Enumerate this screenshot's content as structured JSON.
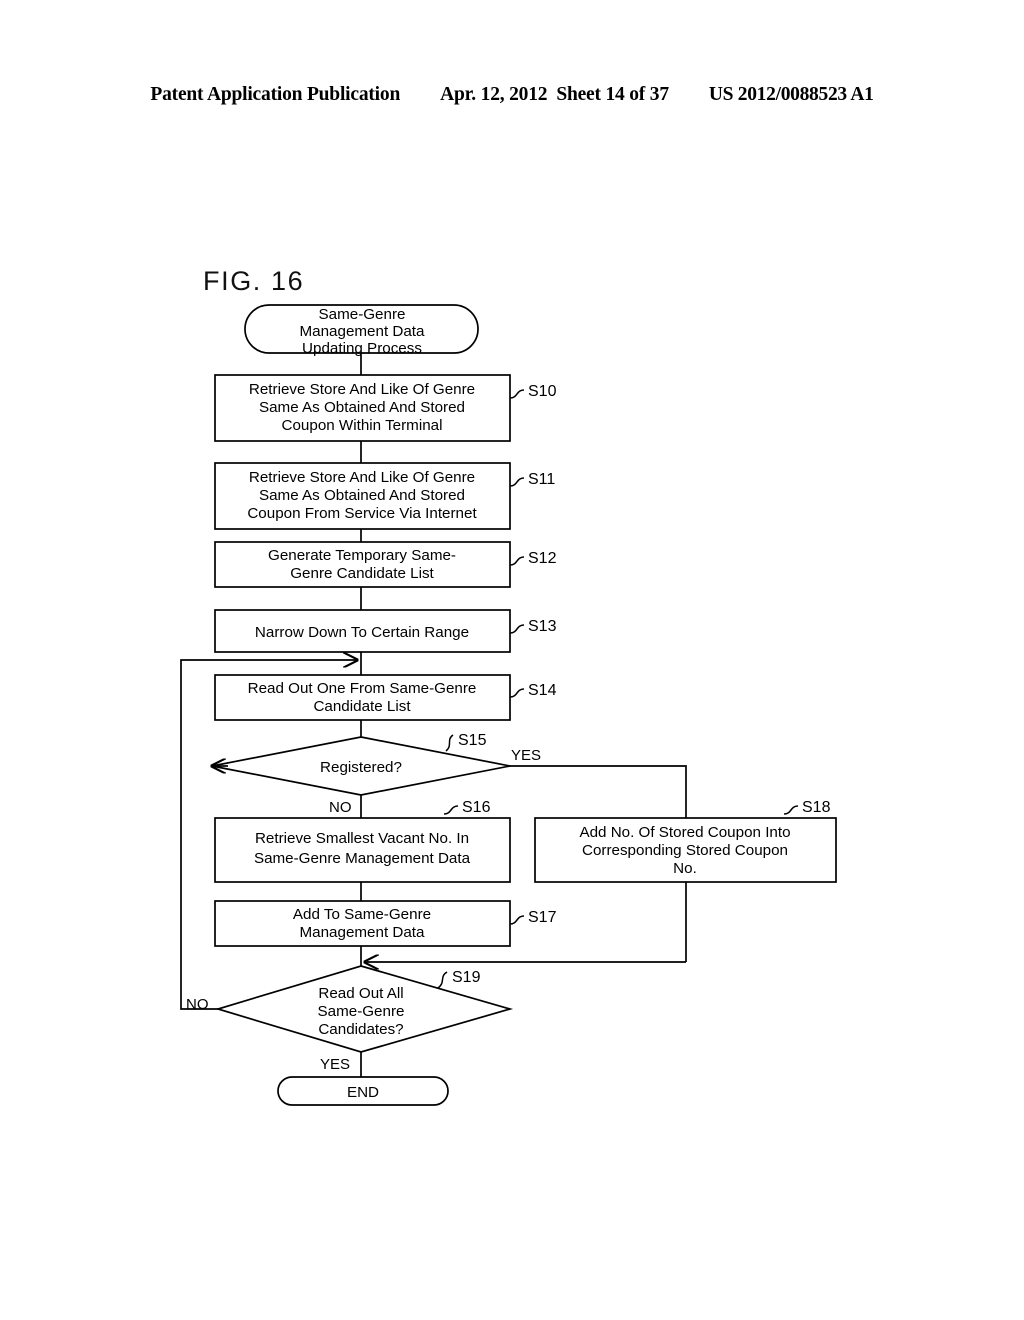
{
  "header": {
    "publication": "Patent Application Publication",
    "date": "Apr. 12, 2012",
    "sheet": "Sheet 14 of 37",
    "document_number": "US 2012/0088523 A1"
  },
  "figure": {
    "label": "FIG. 16",
    "title": "Same-Genre Management Data Updating Process"
  },
  "flowchart": {
    "start": {
      "id": "start",
      "text_lines": [
        "Same-Genre",
        "Management Data",
        "Updating Process"
      ]
    },
    "end": {
      "id": "end",
      "text": "END"
    },
    "steps": [
      {
        "id": "S10",
        "label": "S10",
        "text_lines": [
          "Retrieve Store And Like Of Genre",
          "Same As Obtained And Stored",
          "Coupon Within Terminal"
        ]
      },
      {
        "id": "S11",
        "label": "S11",
        "text_lines": [
          "Retrieve Store And Like Of Genre",
          "Same As Obtained And Stored",
          "Coupon From Service Via Internet"
        ]
      },
      {
        "id": "S12",
        "label": "S12",
        "text_lines": [
          "Generate Temporary Same-",
          "Genre Candidate List"
        ]
      },
      {
        "id": "S13",
        "label": "S13",
        "text_lines": [
          "Narrow Down To Certain Range"
        ]
      },
      {
        "id": "S14",
        "label": "S14",
        "text_lines": [
          "Read Out One From Same-Genre",
          "Candidate List"
        ]
      },
      {
        "id": "S15",
        "label": "S15",
        "type": "decision",
        "text_lines": [
          "Registered?"
        ],
        "yes_label": "YES",
        "no_label": "NO"
      },
      {
        "id": "S16",
        "label": "S16",
        "text_lines": [
          "Retrieve Smallest Vacant No. In",
          "Same-Genre Management Data"
        ]
      },
      {
        "id": "S17",
        "label": "S17",
        "text_lines": [
          "Add To Same-Genre",
          "Management Data"
        ]
      },
      {
        "id": "S18",
        "label": "S18",
        "text_lines": [
          "Add No. Of Stored Coupon Into",
          "Corresponding Stored Coupon",
          "No."
        ]
      },
      {
        "id": "S19",
        "label": "S19",
        "type": "decision",
        "text_lines": [
          "Read Out All",
          "Same-Genre",
          "Candidates?"
        ],
        "yes_label": "YES",
        "no_label": "NO"
      }
    ]
  },
  "colors": {
    "ink": "#000000",
    "paper": "#ffffff"
  }
}
